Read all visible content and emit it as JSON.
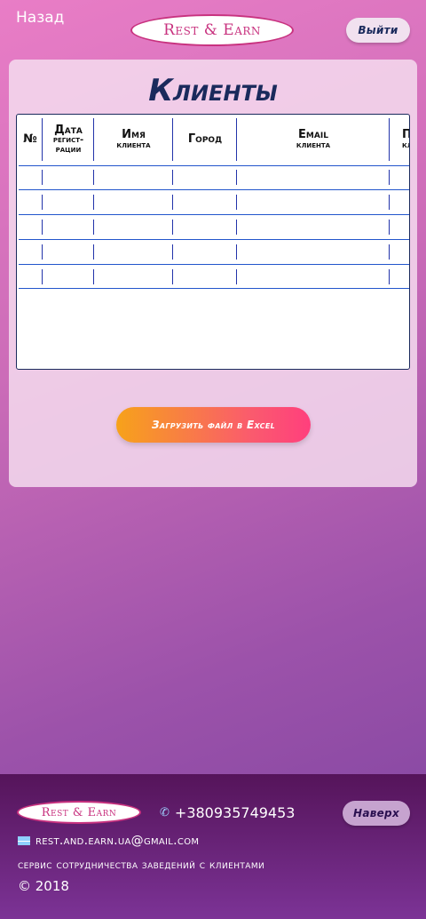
{
  "header": {
    "back_label": "Назад",
    "logo_text": "Rest & Earn",
    "logout_label": "Выйти"
  },
  "main": {
    "title": "Клиенты",
    "table": {
      "columns": [
        {
          "line1": "№",
          "line2": ""
        },
        {
          "line1": "Дата",
          "line2": "регист-",
          "line3": "рации"
        },
        {
          "line1": "Имя",
          "line2": "клиента"
        },
        {
          "line1": "Город",
          "line2": ""
        },
        {
          "line1": "Email",
          "line2": "клиента"
        },
        {
          "line1": "Паро",
          "line2": "клие"
        }
      ],
      "rows": [
        [
          "",
          "",
          "",
          "",
          "",
          ""
        ],
        [
          "",
          "",
          "",
          "",
          "",
          ""
        ],
        [
          "",
          "",
          "",
          "",
          "",
          ""
        ],
        [
          "",
          "",
          "",
          "",
          "",
          ""
        ],
        [
          "",
          "",
          "",
          "",
          "",
          ""
        ]
      ]
    },
    "upload_label": "Загрузить файл в Excel"
  },
  "footer": {
    "logo_text": "Rest & Earn",
    "phone": "+380935749453",
    "up_label": "Наверх",
    "email": "rest.and.earn.ua@gmail.com",
    "tagline": "сервис сотрудничества заведений с клиентами",
    "copyright": "© 2018"
  },
  "colors": {
    "accent": "#c8327f",
    "title": "#1a2a5c",
    "footer_bg": "#55145a"
  }
}
